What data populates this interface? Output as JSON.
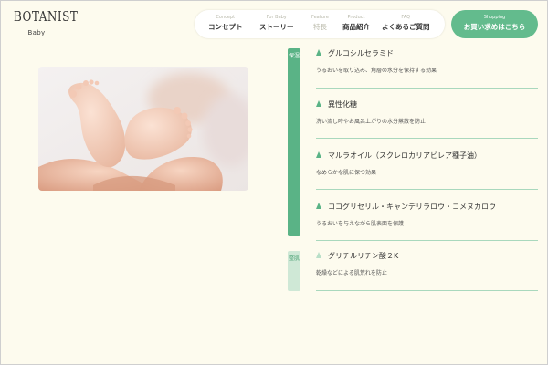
{
  "logo": {
    "main": "BOTANIST",
    "sub": "Baby"
  },
  "nav": {
    "items": [
      {
        "en": "Concept",
        "jp": "コンセプト"
      },
      {
        "en": "For Baby",
        "jp": "ストーリー"
      },
      {
        "en": "Feature",
        "jp": "特長"
      },
      {
        "en": "Product",
        "jp": "商品紹介"
      },
      {
        "en": "FAQ",
        "jp": "よくあるご質問"
      }
    ],
    "shop": {
      "en": "Shopping",
      "jp": "お買い求めはこちら"
    }
  },
  "categories": {
    "moisture": "保湿",
    "skin": "整肌"
  },
  "ingredients": [
    {
      "name": "グルコシルセラミド",
      "desc": "うるおいを取り込み、角層の水分を保持する効果"
    },
    {
      "name": "異性化糖",
      "desc": "洗い流し時やお風呂上がりの水分蒸散を防止"
    },
    {
      "name": "マルラオイル（スクレロカリアビレア種子油）",
      "desc": "なめらかな肌に保つ効果"
    },
    {
      "name": "ココグリセリル・キャンデリラロウ・コメヌカロウ",
      "desc": "うるおいを与えながら肌表面を保護"
    },
    {
      "name": "グリチルリチン酸２K",
      "desc": "乾燥などによる肌荒れを防止"
    }
  ],
  "colors": {
    "accent": "#5ab386",
    "accent_light": "#cfe8d6",
    "background": "#fdfbee",
    "divider": "#a9d8bd"
  }
}
